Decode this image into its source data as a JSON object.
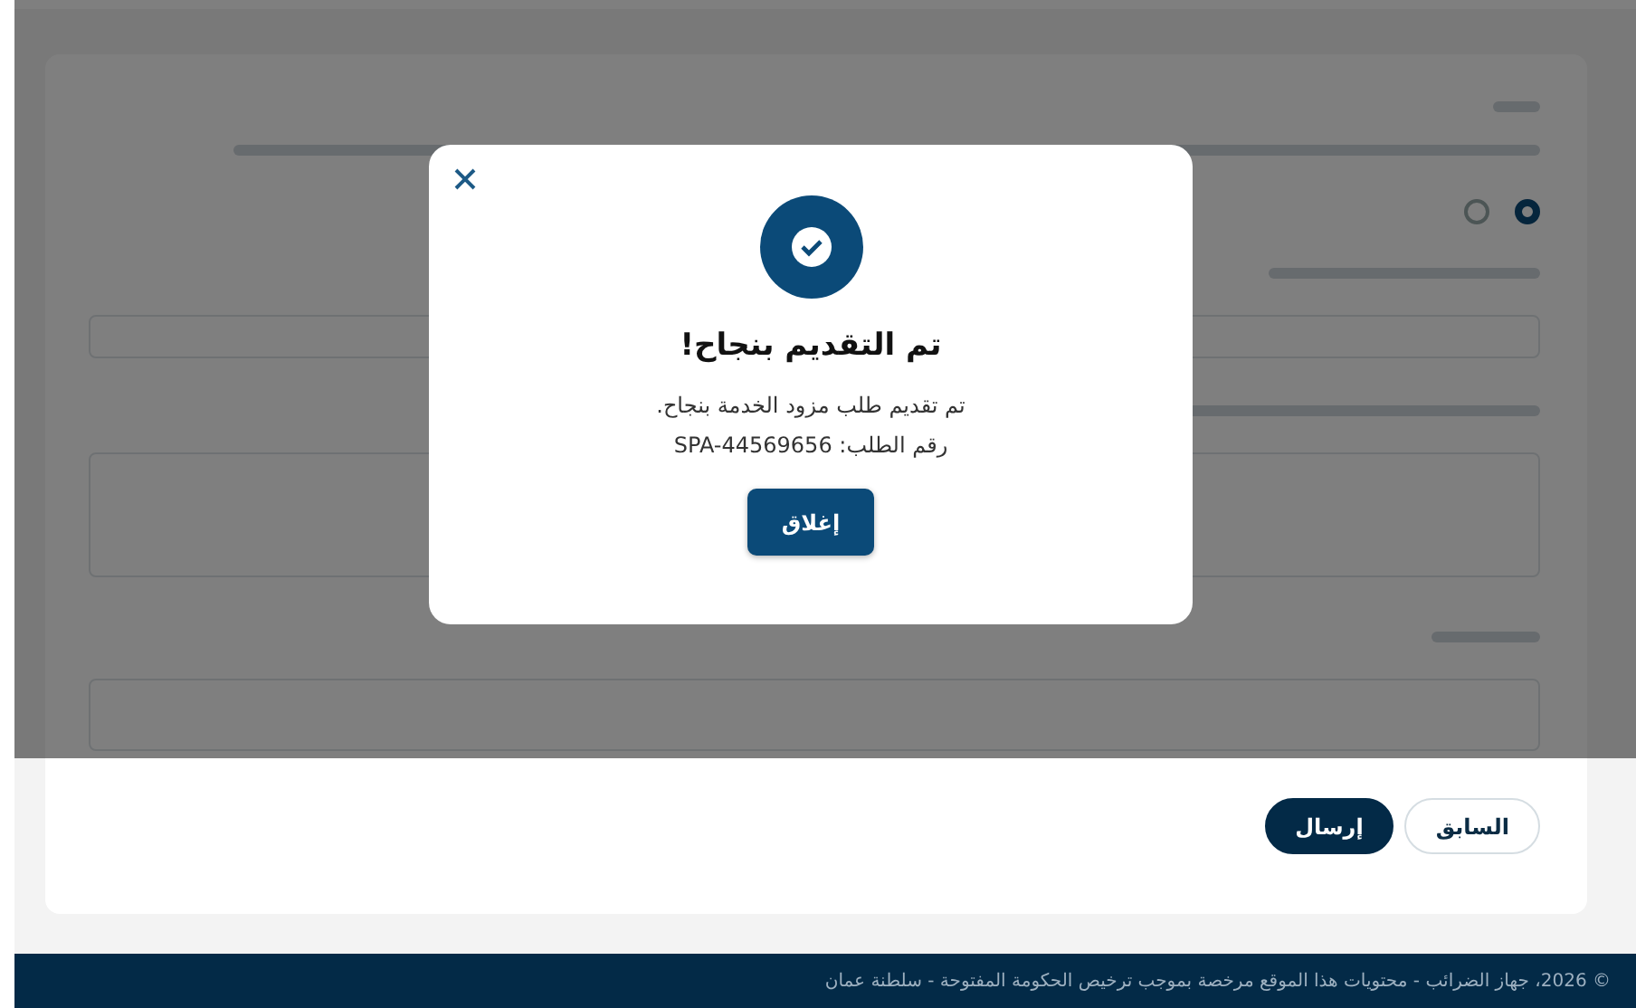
{
  "form": {
    "radio_options": [
      {
        "selected": true
      },
      {
        "selected": false
      }
    ],
    "buttons": [
      {
        "label": "السابق",
        "kind": "secondary"
      },
      {
        "label": "إرسال",
        "kind": "primary"
      }
    ]
  },
  "dialog": {
    "title": "تم التقديم بنجاح!",
    "message": "تم تقديم طلب مزود الخدمة بنجاح.",
    "reference": "رقم الطلب: SPA-44569656",
    "close_button": "إغلاق"
  },
  "footer": {
    "text": "© 2026، جهاز الضرائب - محتويات هذا الموقع مرخصة بموجب ترخيص الحكومة المفتوحة - سلطنة عمان"
  }
}
